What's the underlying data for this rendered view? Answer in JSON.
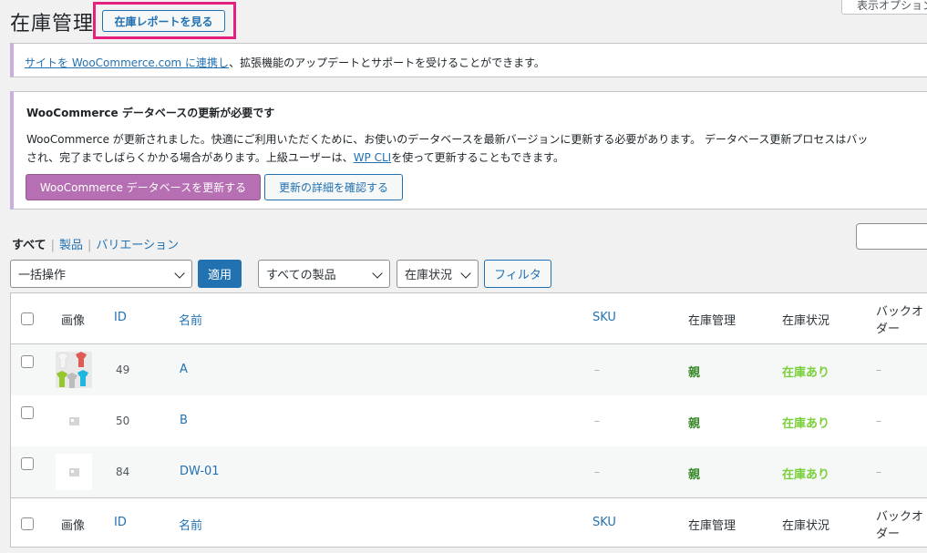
{
  "header": {
    "title": "在庫管理",
    "report_button": "在庫レポートを見る",
    "screen_options": "表示オプション"
  },
  "notice_connect": {
    "link": "サイトを WooCommerce.com に連携し",
    "text": "、拡張機能のアップデートとサポートを受けることができます。"
  },
  "notice_db": {
    "title": "WooCommerce データベースの更新が必要です",
    "line1": "WooCommerce が更新されました。快適にご利用いただくために、お使いのデータベースを最新バージョンに更新する必要があります。 データベース更新プロセスはバッ",
    "line2_pre": "され、完了までしばらくかかる場合があります。上級ユーザーは、",
    "line2_link": "WP CLI",
    "line2_post": "を使って更新することもできます。",
    "update_button": "WooCommerce データベースを更新する",
    "details_button": "更新の詳細を確認する"
  },
  "views": {
    "all": "すべて",
    "products": "製品",
    "variations": "バリエーション",
    "separator": "|"
  },
  "toolbar": {
    "bulk_action": "一括操作",
    "apply": "適用",
    "product_filter": "すべての製品",
    "stock_filter": "在庫状況",
    "filter": "フィルタ"
  },
  "table": {
    "columns": {
      "image": "画像",
      "id": "ID",
      "name": "名前",
      "sku": "SKU",
      "stock_manage": "在庫管理",
      "stock_status": "在庫状況",
      "backorder_1": "バックオ",
      "backorder_2": "ダー"
    },
    "rows": [
      {
        "id": "49",
        "name": "A",
        "sku": "–",
        "manage": "親",
        "status": "在庫あり",
        "backorder": "–",
        "image": "t-shirts-thumbnail"
      },
      {
        "id": "50",
        "name": "B",
        "sku": "–",
        "manage": "親",
        "status": "在庫あり",
        "backorder": "–",
        "image": "placeholder-icon"
      },
      {
        "id": "84",
        "name": "DW-01",
        "sku": "–",
        "manage": "親",
        "status": "在庫あり",
        "backorder": "–",
        "image": "placeholder-icon"
      }
    ]
  },
  "colors": {
    "link": "#2271b1",
    "highlight_border": "#e4217f",
    "woo_purple": "#b56fb2",
    "in_stock": "#7ad03a",
    "parent": "#3a8a2a"
  }
}
